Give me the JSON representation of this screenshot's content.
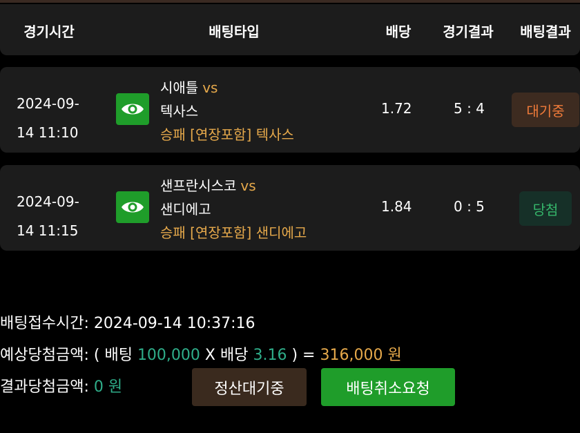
{
  "header": {
    "col_time": "경기시간",
    "col_type": "배팅타입",
    "col_odds": "배당",
    "col_game_result": "경기결과",
    "col_bet_result": "배팅결과"
  },
  "bets": [
    {
      "date": "2024-09-",
      "time": "14 11:10",
      "home": "시애틀",
      "vs": "vs",
      "away": "텍사스",
      "bet_type": "승패 [연장포함] 텍사스",
      "odds": "1.72",
      "score": "5 : 4",
      "result": "대기중"
    },
    {
      "date": "2024-09-",
      "time": "14 11:15",
      "home": "샌프란시스코",
      "vs": "vs",
      "away": "샌디에고",
      "bet_type": "승패 [연장포함] 샌디에고",
      "odds": "1.84",
      "score": "0 : 5",
      "result": "당첨"
    }
  ],
  "summary": {
    "received_label": "배팅접수시간:",
    "received_value": "2024-09-14 10:37:16",
    "expected_label": "예상당첨금액:",
    "open_paren": "(",
    "bet_label": "배팅",
    "bet_amount": "100,000",
    "times": "X",
    "odds_label": "배당",
    "total_odds": "3.16",
    "close_eq": ") =",
    "expected_amount": "316,000 원",
    "result_label": "결과당첨금액:",
    "result_amount": "0 원"
  },
  "buttons": {
    "pending": "정산대기중",
    "cancel": "배팅취소요청"
  },
  "colors": {
    "accent_green": "#1f9d2a",
    "orange": "#e6a94b",
    "teal": "#2fae8a"
  },
  "icons": {
    "view": "eye-icon"
  }
}
